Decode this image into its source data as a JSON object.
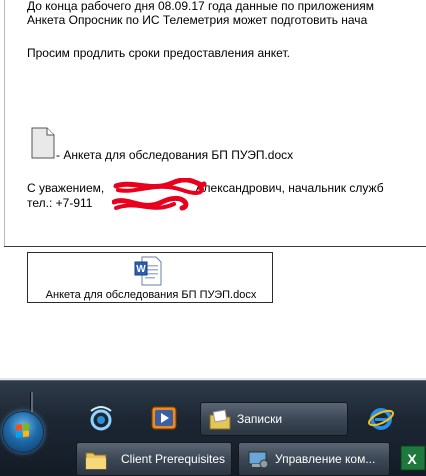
{
  "email": {
    "line1": "До конца рабочего дня 08.09.17 года данные по приложениям",
    "line2": "Анкета Опросник по ИС Телеметрия может подготовить нача",
    "line3": "Просим продлить сроки предоставления анкет.",
    "inline_attachment_text": " - Анкета для обследования БП ПУЭП.docx",
    "signature_line1": "С уважением, ",
    "signature_line1_rest": "Александрович, начальник служб",
    "signature_line2": "тел.: +7-911",
    "attachment_label": "Анкета для обследования БП ПУЭП.docx"
  },
  "taskbar": {
    "start_label": "Start",
    "buttons": [
      {
        "label": "Записки",
        "icon": "notes-folder-icon"
      },
      {
        "label": "Client Prerequisites",
        "icon": "folder-icon"
      },
      {
        "label": "Управление ком...",
        "icon": "computer-management-icon"
      }
    ],
    "quicklaunch": [
      "browser-icon",
      "media-player-icon",
      "internet-explorer-icon",
      "excel-icon"
    ]
  },
  "colors": {
    "redaction": "#e8001c",
    "taskbar": "#1d2734",
    "word_blue": "#2b5fb4",
    "excel_green": "#1e7a3c"
  }
}
